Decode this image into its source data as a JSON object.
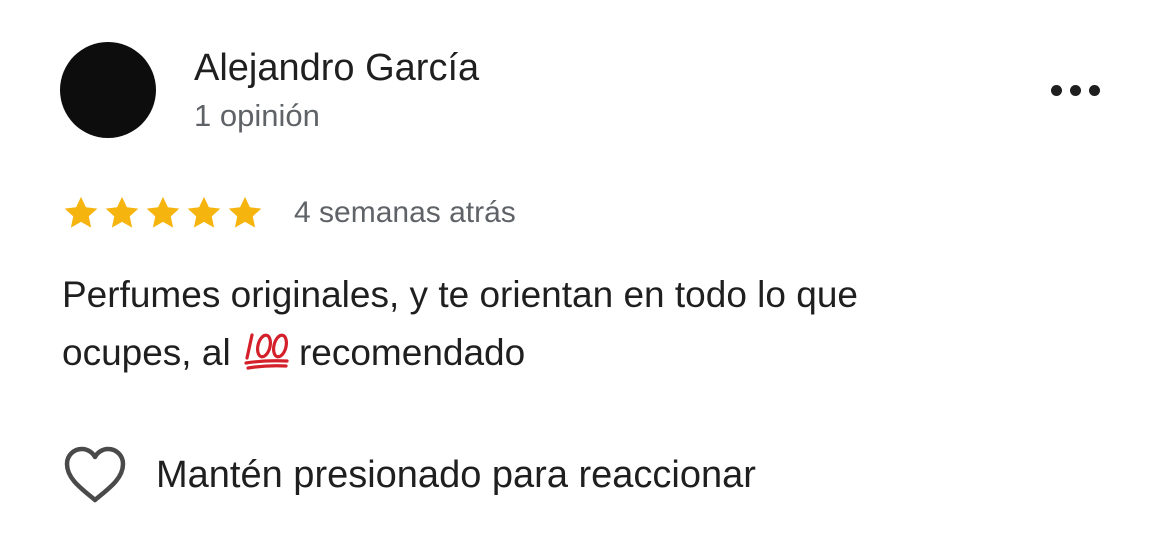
{
  "review": {
    "author": {
      "name": "Alejandro García",
      "meta": "1 opinión"
    },
    "more_icon": "more-horizontal-icon",
    "rating": {
      "stars": 5,
      "max_stars": 5,
      "star_color": "#F6B40E",
      "star_icon": "star-icon"
    },
    "date": "4 semanas atrás",
    "text": {
      "line1": "Perfumes originales, y te orientan en todo lo que",
      "line2_before_emoji": "ocupes, al",
      "emoji": "💯",
      "emoji_icon": "hundred-points-icon",
      "line2_after_emoji": "recomendado"
    }
  },
  "reaction": {
    "icon": "heart-icon",
    "label": "Mantén presionado para reaccionar"
  },
  "colors": {
    "primary_text": "#1F1F1F",
    "secondary_text": "#5F6368",
    "avatar": "#0D0D0D",
    "emoji_red": "#D4202A"
  }
}
